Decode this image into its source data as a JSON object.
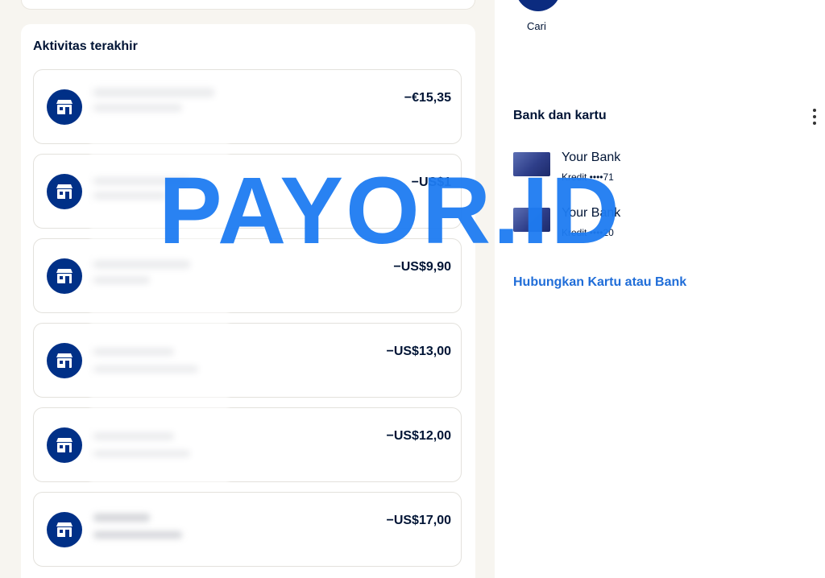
{
  "search": {
    "label": "Cari"
  },
  "activity": {
    "title": "Aktivitas terakhir",
    "transactions": [
      {
        "amount": "−€15,35"
      },
      {
        "amount": "−US$1"
      },
      {
        "amount": "−US$9,90"
      },
      {
        "amount": "−US$13,00"
      },
      {
        "amount": "−US$12,00"
      },
      {
        "amount": "−US$17,00"
      }
    ]
  },
  "banks": {
    "title": "Bank dan kartu",
    "cards": [
      {
        "name": "Your Bank",
        "detail": "Kredit ••••71"
      },
      {
        "name": "Your Bank",
        "detail": "Kredit ••••20"
      }
    ],
    "link_label": "Hubungkan Kartu atau Bank"
  },
  "watermark": "PAYOR.ID",
  "colors": {
    "brand_navy": "#003087",
    "link_blue": "#1f6dd8",
    "watermark_blue": "#1e7cf2"
  }
}
